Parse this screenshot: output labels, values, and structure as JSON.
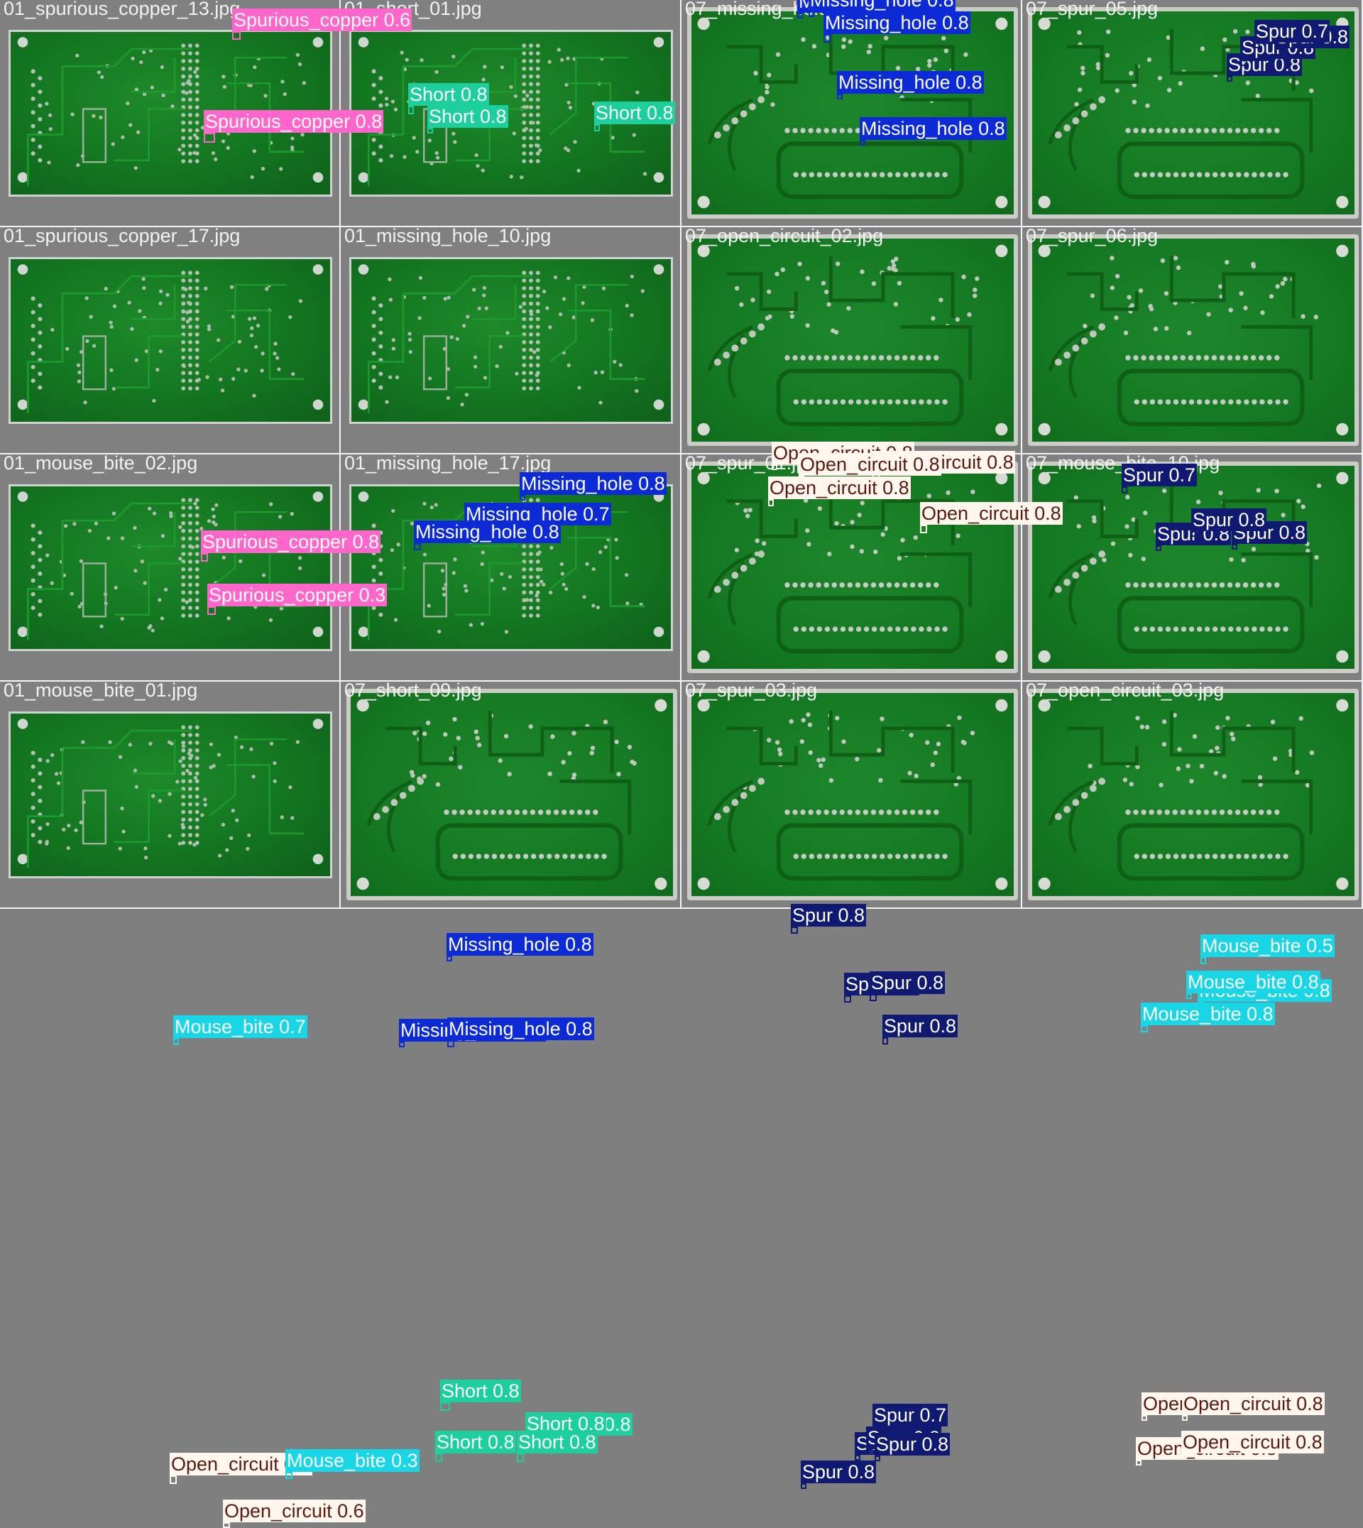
{
  "colors": {
    "Spurious_copper": {
      "bg": "#ff66cc",
      "fg": "#ffffff"
    },
    "Short": {
      "bg": "#1ecf9e",
      "fg": "#ffffff"
    },
    "Missing_hole": {
      "bg": "#0c2bd6",
      "fg": "#ffffff"
    },
    "Spur": {
      "bg": "#111a73",
      "fg": "#ffffff"
    },
    "Open_circuit": {
      "bg": "#fff6ee",
      "fg": "#5a1a10"
    },
    "Mouse_bite": {
      "bg": "#19d6e6",
      "fg": "#ffffff"
    }
  },
  "tiles": [
    {
      "filename": "01_spurious_copper_13.jpg",
      "board": "front",
      "detections": [
        {
          "cls": "Spurious_copper",
          "label": "Spurious_copper 0.6"
        },
        {
          "cls": "Spurious_copper",
          "label": "Spurious_copper 0.8"
        }
      ]
    },
    {
      "filename": "01_short_01.jpg",
      "board": "front",
      "detections": [
        {
          "cls": "Short",
          "label": "Short 0.8"
        },
        {
          "cls": "Short",
          "label": "Short 0.8"
        },
        {
          "cls": "Short",
          "label": "Short 0.8"
        }
      ]
    },
    {
      "filename": "07_missing_hole_06.jpg",
      "board": "back",
      "detections": [
        {
          "cls": "Missing_hole",
          "label": "Missing_hole 0.8"
        },
        {
          "cls": "Missing_hole",
          "label": "Missing_hole 0.8"
        },
        {
          "cls": "Missing_hole",
          "label": "Missing_hole 0.8"
        },
        {
          "cls": "Missing_hole",
          "label": "Missing_hole 0.8"
        },
        {
          "cls": "Missing_hole",
          "label": "Missing_hole 0.8"
        }
      ]
    },
    {
      "filename": "07_spur_05.jpg",
      "board": "back",
      "detections": [
        {
          "cls": "Spur",
          "label": "Spur 0.8"
        },
        {
          "cls": "Spur",
          "label": "Spur 0.8"
        },
        {
          "cls": "Spur",
          "label": "Spur 0.8"
        },
        {
          "cls": "Spur",
          "label": "Spur 0.7"
        }
      ]
    },
    {
      "filename": "01_spurious_copper_17.jpg",
      "board": "front",
      "detections": [
        {
          "cls": "Spurious_copper",
          "label": "Spurious_copper 0.8"
        },
        {
          "cls": "Spurious_copper",
          "label": "Spurious_copper 0.3"
        }
      ]
    },
    {
      "filename": "01_missing_hole_10.jpg",
      "board": "front",
      "detections": [
        {
          "cls": "Missing_hole",
          "label": "Missing_hole 0.8"
        },
        {
          "cls": "Missing_hole",
          "label": "Missing_hole 0.7"
        },
        {
          "cls": "Missing_hole",
          "label": "Missing_hole 0.8"
        }
      ]
    },
    {
      "filename": "07_open_circuit_02.jpg",
      "board": "back",
      "detections": [
        {
          "cls": "Open_circuit",
          "label": "Open_circuit 0.8"
        },
        {
          "cls": "Open_circuit",
          "label": "Open_circuit 0.8"
        },
        {
          "cls": "Open_circuit",
          "label": "Open_circuit 0.8"
        },
        {
          "cls": "Open_circuit",
          "label": "Open_circuit 0.8"
        },
        {
          "cls": "Open_circuit",
          "label": "Open_circuit 0.8"
        }
      ]
    },
    {
      "filename": "07_spur_06.jpg",
      "board": "back",
      "detections": [
        {
          "cls": "Spur",
          "label": "Spur 0.7"
        },
        {
          "cls": "Spur",
          "label": "Spur 0.8"
        },
        {
          "cls": "Spur",
          "label": "Spur 0.8"
        },
        {
          "cls": "Spur",
          "label": "Spur 0.8"
        }
      ]
    },
    {
      "filename": "01_mouse_bite_02.jpg",
      "board": "front",
      "detections": [
        {
          "cls": "Mouse_bite",
          "label": "Mouse_bite 0.7"
        }
      ]
    },
    {
      "filename": "01_missing_hole_17.jpg",
      "board": "front",
      "detections": [
        {
          "cls": "Missing_hole",
          "label": "Missing_hole 0.8"
        },
        {
          "cls": "Missing_hole",
          "label": "Missing_hole 0.8"
        },
        {
          "cls": "Missing_hole",
          "label": "Missing_hole 0.8"
        }
      ]
    },
    {
      "filename": "07_spur_01.jpg",
      "board": "back",
      "detections": [
        {
          "cls": "Spur",
          "label": "Spur 0.8"
        },
        {
          "cls": "Spur",
          "label": "Spur 0.8"
        },
        {
          "cls": "Spur",
          "label": "Spur 0.8"
        },
        {
          "cls": "Spur",
          "label": "Spur 0.8"
        }
      ]
    },
    {
      "filename": "07_mouse_bite_10.jpg",
      "board": "back",
      "detections": [
        {
          "cls": "Mouse_bite",
          "label": "Mouse_bite 0.5"
        },
        {
          "cls": "Mouse_bite",
          "label": "Mouse_bite 0.8"
        },
        {
          "cls": "Mouse_bite",
          "label": "Mouse_bite 0.8"
        },
        {
          "cls": "Mouse_bite",
          "label": "Mouse_bite 0.8"
        }
      ]
    },
    {
      "filename": "01_mouse_bite_01.jpg",
      "board": "front",
      "detections": [
        {
          "cls": "Open_circuit",
          "label": "Open_circuit 0.8"
        },
        {
          "cls": "Mouse_bite",
          "label": "Mouse_bite 0.3"
        },
        {
          "cls": "Open_circuit",
          "label": "Open_circuit 0.6"
        }
      ]
    },
    {
      "filename": "07_short_09.jpg",
      "board": "back",
      "detections": [
        {
          "cls": "Short",
          "label": "Short 0.8"
        },
        {
          "cls": "Short",
          "label": "Short 0.8"
        },
        {
          "cls": "Short",
          "label": "Short 0.8"
        },
        {
          "cls": "Short",
          "label": "Short 0.8"
        },
        {
          "cls": "Short",
          "label": "Short 0.8"
        }
      ]
    },
    {
      "filename": "07_spur_03.jpg",
      "board": "back",
      "detections": [
        {
          "cls": "Spur",
          "label": "Spur 0.8"
        },
        {
          "cls": "Spur",
          "label": "Spur 0.7"
        },
        {
          "cls": "Spur",
          "label": "Spur 0.8"
        },
        {
          "cls": "Spur",
          "label": "Spur 0.8"
        },
        {
          "cls": "Spur",
          "label": "Spur 0.8"
        }
      ]
    },
    {
      "filename": "07_open_circuit_03.jpg",
      "board": "back",
      "detections": [
        {
          "cls": "Open_circuit",
          "label": "Open_circuit 0.8"
        },
        {
          "cls": "Open_circuit",
          "label": "Open_circuit 0.8"
        },
        {
          "cls": "Open_circuit",
          "label": "Open_circuit 0.8"
        },
        {
          "cls": "Open_circuit",
          "label": "Open_circuit 0.8"
        }
      ]
    }
  ]
}
